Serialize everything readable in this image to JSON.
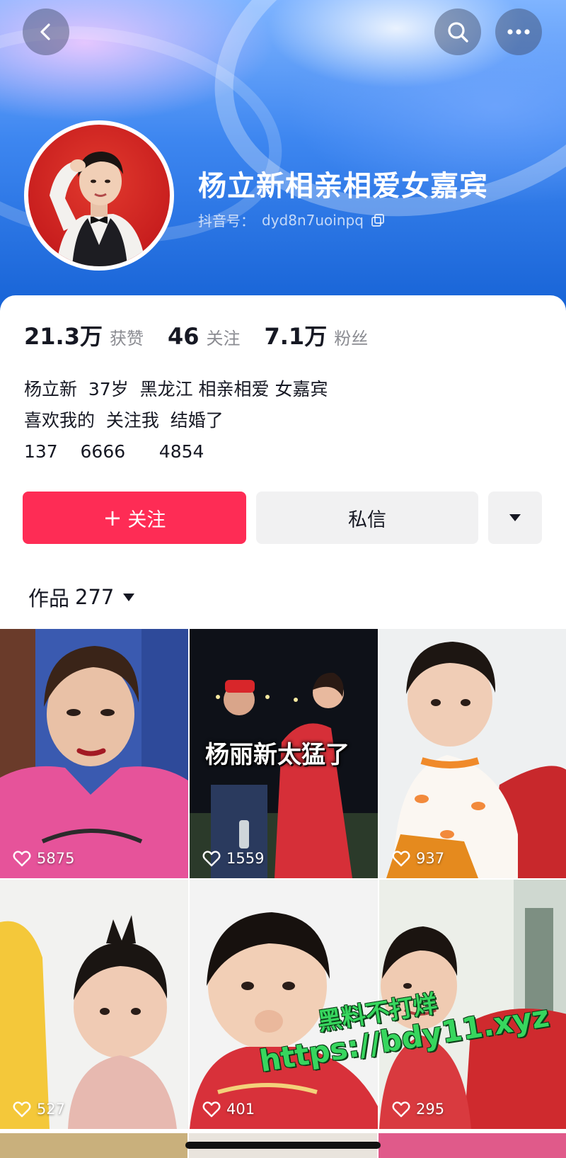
{
  "header": {
    "back_icon": "chevron-left-icon",
    "search_icon": "search-icon",
    "more_icon": "more-horizontal-icon"
  },
  "profile": {
    "name": "杨立新相亲相爱女嘉宾",
    "id_label": "抖音号：",
    "id_value": "dyd8n7uoinpq",
    "copy_icon": "copy-icon"
  },
  "stats": [
    {
      "num": "21.3万",
      "label": "获赞"
    },
    {
      "num": "46",
      "label": "关注"
    },
    {
      "num": "7.1万",
      "label": "粉丝"
    }
  ],
  "bio": [
    "杨立新  37岁  黑龙江 相亲相爱 女嘉宾",
    "喜欢我的  关注我  结婚了",
    "137    6666      4854"
  ],
  "actions": {
    "follow_plus": "+",
    "follow_label": "关注",
    "message_label": "私信",
    "more_icon": "triangle-down-icon"
  },
  "works": {
    "tab_label": "作品",
    "count": "277",
    "dropdown_icon": "triangle-down-icon"
  },
  "videos": [
    {
      "likes": "5875",
      "caption": ""
    },
    {
      "likes": "1559",
      "caption": "杨丽新太猛了"
    },
    {
      "likes": "937",
      "caption": ""
    },
    {
      "likes": "527",
      "caption": ""
    },
    {
      "likes": "401",
      "caption": ""
    },
    {
      "likes": "295",
      "caption": ""
    }
  ],
  "watermark": {
    "line1": "黑料不打烊",
    "line2": "https://bdy11.xyz"
  },
  "colors": {
    "accent": "#fe2c55",
    "header_blue": "#1763d6"
  }
}
